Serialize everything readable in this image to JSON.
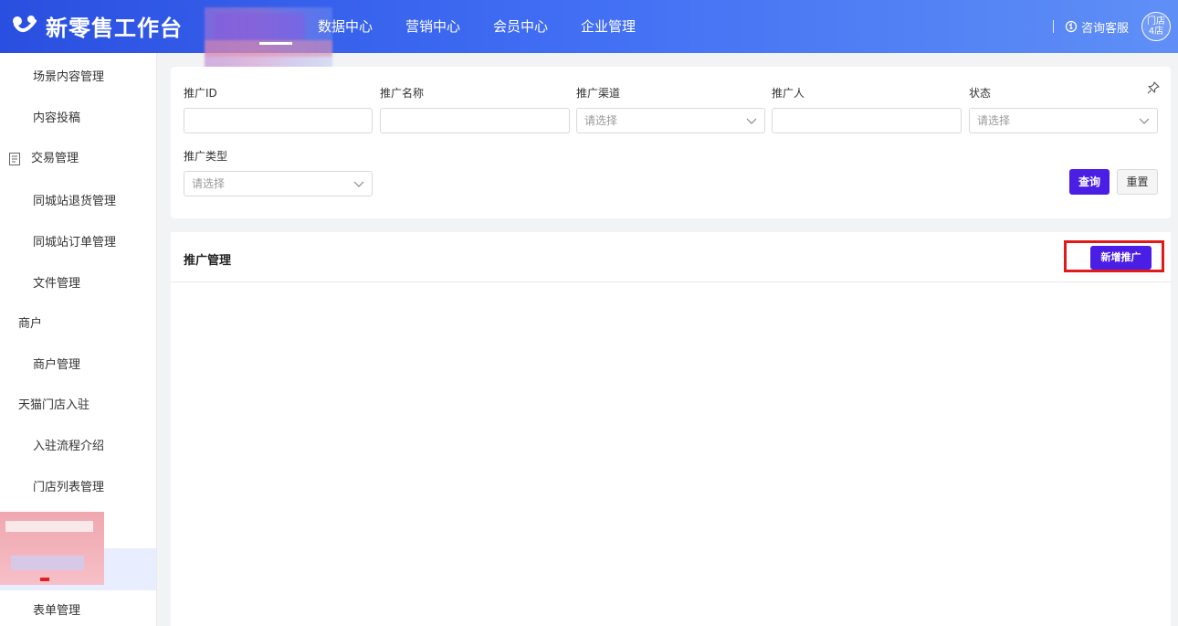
{
  "header": {
    "app_title": "新零售工作台",
    "nav": [
      "数据中心",
      "营销中心",
      "会员中心",
      "企业管理"
    ],
    "support_label": "咨询客服",
    "store_badge_line1": "门店",
    "store_badge_line2": "4店"
  },
  "sidebar": {
    "items": [
      "场景内容管理",
      "内容投稿",
      "交易管理",
      "同城站退货管理",
      "同城站订单管理",
      "文件管理",
      "商户",
      "商户管理",
      "天猫门店入驻",
      "入驻流程介绍",
      "门店列表管理",
      "表单管理"
    ]
  },
  "filters": {
    "promo_id_label": "推广ID",
    "promo_name_label": "推广名称",
    "promo_channel_label": "推广渠道",
    "promo_channel_placeholder": "请选择",
    "promoter_label": "推广人",
    "status_label": "状态",
    "status_placeholder": "请选择",
    "promo_type_label": "推广类型",
    "promo_type_placeholder": "请选择",
    "query_button": "查询",
    "reset_button": "重置"
  },
  "management": {
    "title": "推广管理",
    "add_button": "新增推广"
  },
  "colors": {
    "primary": "#4b1ee6",
    "header_start": "#2a4fe0",
    "header_end": "#5f8ff6",
    "highlight": "#e01919"
  }
}
